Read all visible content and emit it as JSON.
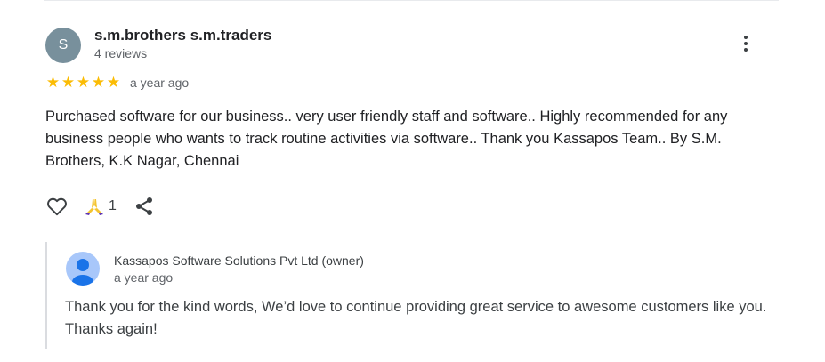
{
  "review": {
    "avatar_letter": "S",
    "avatar_color": "#78909c",
    "reviewer_name": "s.m.brothers s.m.traders",
    "reviewer_reviews": "4 reviews",
    "rating": 5,
    "rating_max": 5,
    "star_glyph": "★",
    "star_color": "#fbbc04",
    "time": "a year ago",
    "text": "Purchased software for our business.. very user friendly staff and software.. Highly recommended for any business people who wants to track routine activities via software.. Thank you Kassapos Team.. By S.M. Brothers, K.K Nagar, Chennai",
    "reaction_count": "1",
    "icons": [
      "more-options-icon",
      "like-heart-icon",
      "reaction-hands-icon",
      "share-icon"
    ]
  },
  "owner_reply": {
    "owner_name": "Kassapos Software Solutions Pvt Ltd (owner)",
    "time": "a year ago",
    "text": "Thank you for the kind words, We’d love to continue providing great service to awesome customers like you. Thanks again!",
    "avatar_color": "#a8c7fa"
  }
}
